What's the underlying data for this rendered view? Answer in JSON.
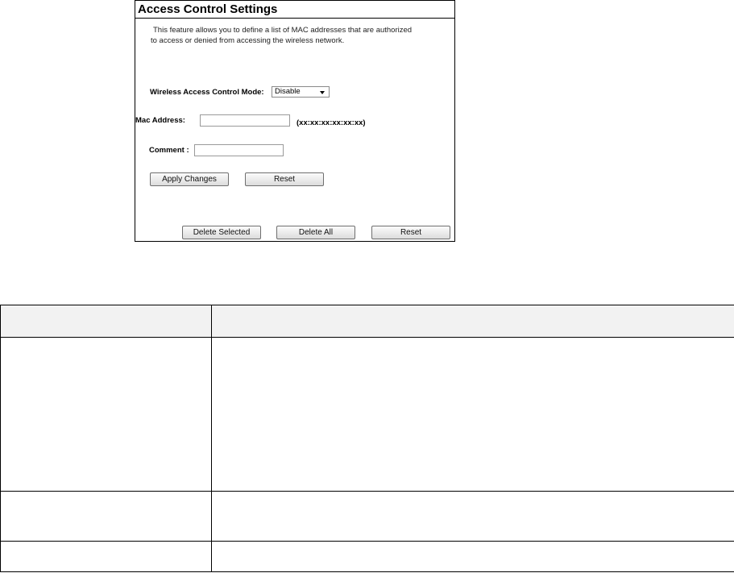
{
  "panel": {
    "title": "Access Control Settings",
    "description": [
      "This feature allows you to define a list of MAC addresses that are authorized",
      "to access or denied from accessing the wireless network."
    ],
    "mode_label": "Wireless Access Control Mode:",
    "mode_value": "Disable",
    "mac_label": "Mac Address:",
    "mac_value": "",
    "mac_hint": "(xx:xx:xx:xx:xx:xx)",
    "comment_label": "Comment :",
    "comment_value": "",
    "apply_label": "Apply Changes",
    "reset_label": "Reset",
    "delete_selected_label": "Delete Selected",
    "delete_all_label": "Delete All",
    "reset2_label": "Reset"
  },
  "table": {
    "header": [
      "",
      ""
    ],
    "rows": [
      [
        "",
        ""
      ],
      [
        "",
        ""
      ],
      [
        "",
        ""
      ]
    ]
  }
}
